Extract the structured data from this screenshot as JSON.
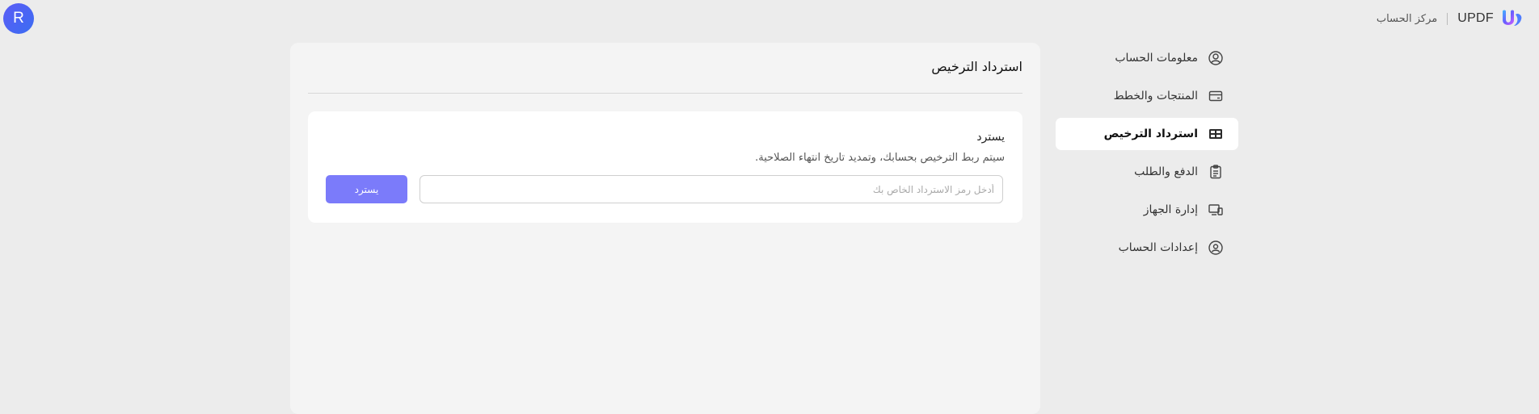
{
  "header": {
    "avatar_letter": "R",
    "brand_name": "UPDF",
    "account_center": "مركز الحساب"
  },
  "sidebar": {
    "items": [
      {
        "label": "معلومات الحساب",
        "icon": "user-circle-icon",
        "active": false
      },
      {
        "label": "المنتجات والخطط",
        "icon": "card-icon",
        "active": false
      },
      {
        "label": "استرداد الترخيص",
        "icon": "ticket-icon",
        "active": true
      },
      {
        "label": "الدفع والطلب",
        "icon": "clipboard-icon",
        "active": false
      },
      {
        "label": "إدارة الجهاز",
        "icon": "devices-icon",
        "active": false
      },
      {
        "label": "إعدادات الحساب",
        "icon": "user-shield-icon",
        "active": false
      }
    ]
  },
  "main": {
    "title": "استرداد الترخيص",
    "card": {
      "title": "يسترد",
      "description": "سيتم ربط الترخيص بحسابك، وتمديد تاريخ انتهاء الصلاحية.",
      "input_placeholder": "أدخل رمز الاسترداد الخاص بك",
      "input_value": "",
      "button_label": "يسترد"
    }
  },
  "colors": {
    "accent": "#7b7bfa",
    "avatar": "#4a64f4",
    "background": "#ececec",
    "panel": "#f4f4f4"
  }
}
